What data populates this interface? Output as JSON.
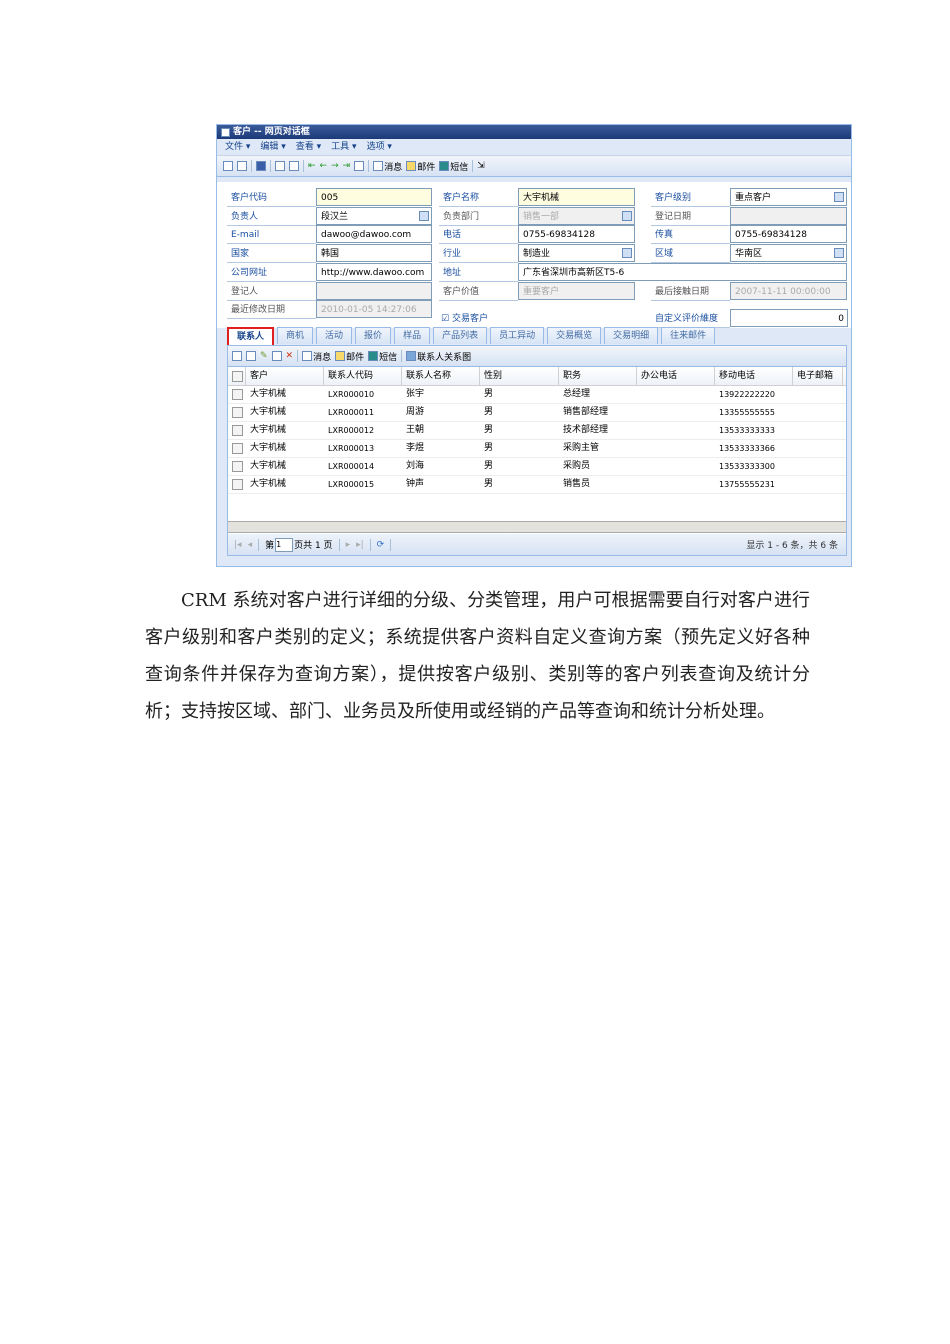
{
  "window": {
    "title": "客户 -- 网页对话框"
  },
  "menu": [
    "文件 ▾",
    "编辑 ▾",
    "查看 ▾",
    "工具 ▾",
    "选项 ▾"
  ],
  "toolbar": {
    "message": "消息",
    "mail": "邮件",
    "sms": "短信"
  },
  "form": [
    {
      "label": "客户代码",
      "value": "005",
      "style": "yel",
      "blue": true
    },
    {
      "label": "客户名称",
      "value": "大宇机械",
      "style": "yel",
      "blue": true
    },
    {
      "label": "客户级别",
      "value": "重点客户",
      "style": "",
      "blue": true,
      "pick": true
    },
    {
      "label": "负责人",
      "value": "段汉兰",
      "style": "",
      "blue": true,
      "pick": true
    },
    {
      "label": "负责部门",
      "value": "销售一部",
      "style": "dis",
      "blue": false,
      "pick": true
    },
    {
      "label": "登记日期",
      "value": "",
      "style": "dis",
      "blue": false
    },
    {
      "label": "E-mail",
      "value": "dawoo@dawoo.com",
      "style": "",
      "blue": true
    },
    {
      "label": "电话",
      "value": "0755-69834128",
      "style": "",
      "blue": true
    },
    {
      "label": "传真",
      "value": "0755-69834128",
      "style": "",
      "blue": true
    },
    {
      "label": "国家",
      "value": "韩国",
      "style": "",
      "blue": true
    },
    {
      "label": "行业",
      "value": "制造业",
      "style": "",
      "blue": true,
      "pick": true
    },
    {
      "label": "区域",
      "value": "华南区",
      "style": "",
      "blue": true,
      "pick": true
    },
    {
      "label": "公司网址",
      "value": "http://www.dawoo.com",
      "style": "",
      "blue": true
    },
    {
      "label": "地址",
      "value": "广东省深圳市高新区T5-6",
      "style": "",
      "blue": true,
      "wide": true
    },
    {
      "label": "登记人",
      "value": "",
      "style": "dis",
      "blue": false
    },
    {
      "label": "客户价值",
      "value": "重要客户",
      "style": "dis",
      "blue": false
    },
    {
      "label": "最后接触日期",
      "value": "2007-11-11 00:00:00",
      "style": "dis",
      "blue": false
    },
    {
      "label": "最近修改日期",
      "value": "2010-01-05 14:27:06",
      "style": "dis",
      "blue": false
    }
  ],
  "trade_customer": "交易客户",
  "custom_rating": {
    "label": "自定义评价維度",
    "value": "0"
  },
  "tabs": [
    "联系人",
    "商机",
    "活动",
    "报价",
    "样品",
    "产品列表",
    "员工异动",
    "交易概览",
    "交易明细",
    "往来邮件"
  ],
  "grid_toolbar": {
    "message": "消息",
    "mail": "邮件",
    "sms": "短信",
    "relation": "联系人关系图"
  },
  "columns": [
    "客户",
    "联系人代码",
    "联系人名称",
    "性别",
    "职务",
    "办公电话",
    "移动电话",
    "电子邮箱"
  ],
  "rows": [
    [
      "大宇机械",
      "LXR000010",
      "张宇",
      "男",
      "总经理",
      "",
      "13922222220",
      ""
    ],
    [
      "大宇机械",
      "LXR000011",
      "周游",
      "男",
      "销售部经理",
      "",
      "13355555555",
      ""
    ],
    [
      "大宇机械",
      "LXR000012",
      "王朝",
      "男",
      "技术部经理",
      "",
      "13533333333",
      ""
    ],
    [
      "大宇机械",
      "LXR000013",
      "李煜",
      "男",
      "采购主管",
      "",
      "13533333366",
      ""
    ],
    [
      "大宇机械",
      "LXR000014",
      "刘海",
      "男",
      "采购员",
      "",
      "13533333300",
      ""
    ],
    [
      "大宇机械",
      "LXR000015",
      "钟声",
      "男",
      "销售员",
      "",
      "13755555231",
      ""
    ]
  ],
  "pager": {
    "page_prefix": "第",
    "page": "1",
    "page_suffix": "页共 1 页",
    "summary": "显示 1 - 6 条，共 6 条"
  },
  "paragraph": "CRM 系统对客户进行详细的分级、分类管理，用户可根据需要自行对客户进行客户级别和客户类别的定义；系统提供客户资料自定义查询方案（预先定义好各种查询条件并保存为查询方案），提供按客户级别、类别等的客户列表查询及统计分析；支持按区域、部门、业务员及所使用或经销的产品等查询和统计分析处理。"
}
